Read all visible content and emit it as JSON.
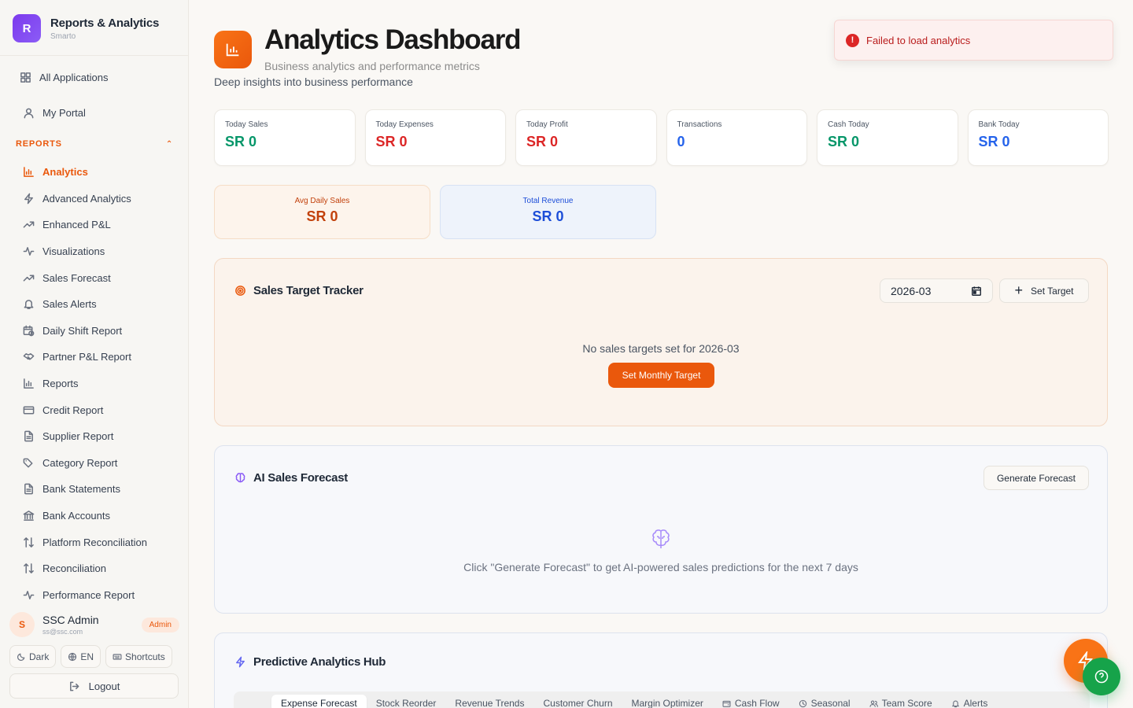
{
  "brand": {
    "initial": "R",
    "title": "Reports & Analytics",
    "subtitle": "Smarto"
  },
  "sidebar": {
    "all_apps": "All Applications",
    "my_portal": "My Portal",
    "section": "REPORTS",
    "items": [
      {
        "label": "Analytics",
        "icon": "bar-chart-icon"
      },
      {
        "label": "Advanced Analytics",
        "icon": "zap-icon"
      },
      {
        "label": "Enhanced P&L",
        "icon": "trending-up-icon"
      },
      {
        "label": "Visualizations",
        "icon": "activity-icon"
      },
      {
        "label": "Sales Forecast",
        "icon": "trending-up-icon"
      },
      {
        "label": "Sales Alerts",
        "icon": "bell-icon"
      },
      {
        "label": "Daily Shift Report",
        "icon": "calendar-clock-icon"
      },
      {
        "label": "Partner P&L Report",
        "icon": "handshake-icon"
      },
      {
        "label": "Reports",
        "icon": "bar-chart-icon"
      },
      {
        "label": "Credit Report",
        "icon": "credit-card-icon"
      },
      {
        "label": "Supplier Report",
        "icon": "file-text-icon"
      },
      {
        "label": "Category Report",
        "icon": "tags-icon"
      },
      {
        "label": "Bank Statements",
        "icon": "file-text-icon"
      },
      {
        "label": "Bank Accounts",
        "icon": "bank-icon"
      },
      {
        "label": "Platform Reconciliation",
        "icon": "arrows-up-down-icon"
      },
      {
        "label": "Reconciliation",
        "icon": "arrows-up-down-icon"
      },
      {
        "label": "Performance Report",
        "icon": "activity-icon"
      }
    ],
    "active_index": 0
  },
  "user": {
    "initial": "S",
    "name": "SSC Admin",
    "email": "ss@ssc.com",
    "role": "Admin"
  },
  "utils": {
    "dark": "Dark",
    "lang": "EN",
    "shortcuts": "Shortcuts",
    "logout": "Logout"
  },
  "header": {
    "title": "Analytics Dashboard",
    "subtitle": "Business analytics and performance metrics",
    "description": "Deep insights into business performance"
  },
  "toast": {
    "message": "Failed to load analytics",
    "icon": "!"
  },
  "stats": [
    {
      "label": "Today Sales",
      "value": "SR 0",
      "color": "#059669"
    },
    {
      "label": "Today Expenses",
      "value": "SR 0",
      "color": "#dc2626"
    },
    {
      "label": "Today Profit",
      "value": "SR 0",
      "color": "#dc2626"
    },
    {
      "label": "Transactions",
      "value": "0",
      "color": "#2563eb"
    },
    {
      "label": "Cash Today",
      "value": "SR 0",
      "color": "#059669"
    },
    {
      "label": "Bank Today",
      "value": "SR 0",
      "color": "#2563eb"
    }
  ],
  "mini_stats": {
    "avg": {
      "label": "Avg Daily Sales",
      "value": "SR 0",
      "color": "#c2410c"
    },
    "revenue": {
      "label": "Total Revenue",
      "value": "SR 0",
      "color": "#1d4ed8"
    }
  },
  "target": {
    "title": "Sales Target Tracker",
    "month": "2026-03",
    "set_target": "Set Target",
    "empty": "No sales targets set for 2026-03",
    "cta": "Set Monthly Target"
  },
  "forecast": {
    "title": "AI Sales Forecast",
    "button": "Generate Forecast",
    "empty": "Click \"Generate Forecast\" to get AI-powered sales predictions for the next 7 days"
  },
  "predictive": {
    "title": "Predictive Analytics Hub",
    "tabs": [
      {
        "label": "Expense Forecast",
        "icon": ""
      },
      {
        "label": "Stock Reorder",
        "icon": ""
      },
      {
        "label": "Revenue Trends",
        "icon": ""
      },
      {
        "label": "Customer Churn",
        "icon": ""
      },
      {
        "label": "Margin Optimizer",
        "icon": ""
      },
      {
        "label": "Cash Flow",
        "icon": "wallet-icon"
      },
      {
        "label": "Seasonal",
        "icon": "clock-icon"
      },
      {
        "label": "Team Score",
        "icon": "users-icon"
      },
      {
        "label": "Alerts",
        "icon": "bell-icon"
      }
    ],
    "active_tab": 0
  }
}
